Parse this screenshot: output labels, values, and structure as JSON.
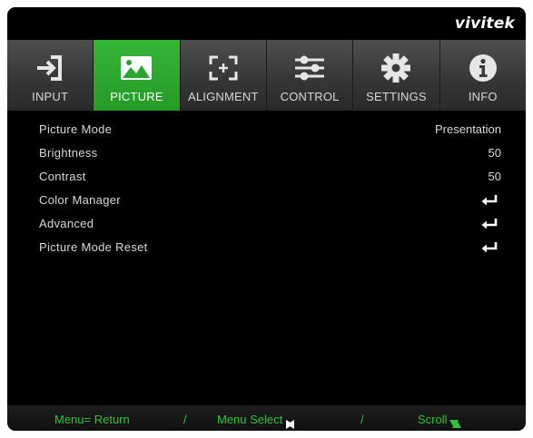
{
  "brand": "vivitek",
  "tabs": [
    {
      "label": "INPUT",
      "icon": "input-arrow-icon",
      "active": false
    },
    {
      "label": "PICTURE",
      "icon": "picture-landscape-icon",
      "active": true
    },
    {
      "label": "ALIGNMENT",
      "icon": "alignment-corners-icon",
      "active": false
    },
    {
      "label": "CONTROL",
      "icon": "control-sliders-icon",
      "active": false
    },
    {
      "label": "SETTINGS",
      "icon": "gear-icon",
      "active": false
    },
    {
      "label": "INFO",
      "icon": "info-icon",
      "active": false
    }
  ],
  "menu": {
    "items": [
      {
        "name": "Picture Mode",
        "value": "Presentation"
      },
      {
        "name": "Brightness",
        "value": "50"
      },
      {
        "name": "Contrast",
        "value": "50"
      },
      {
        "name": "Color Manager",
        "value": "",
        "icon": "enter-arrow-icon"
      },
      {
        "name": "Advanced",
        "value": "",
        "icon": "enter-arrow-icon"
      },
      {
        "name": "Picture Mode Reset",
        "value": "",
        "icon": "enter-arrow-icon"
      }
    ]
  },
  "footer": {
    "menu_return": "Menu= Return",
    "sep1": "/",
    "menu_select": "Menu Select",
    "sep2": "/",
    "scroll": "Scroll"
  },
  "colors": {
    "accent": "#2aa52d",
    "footer_text": "#35c23a",
    "background": "#000000"
  }
}
